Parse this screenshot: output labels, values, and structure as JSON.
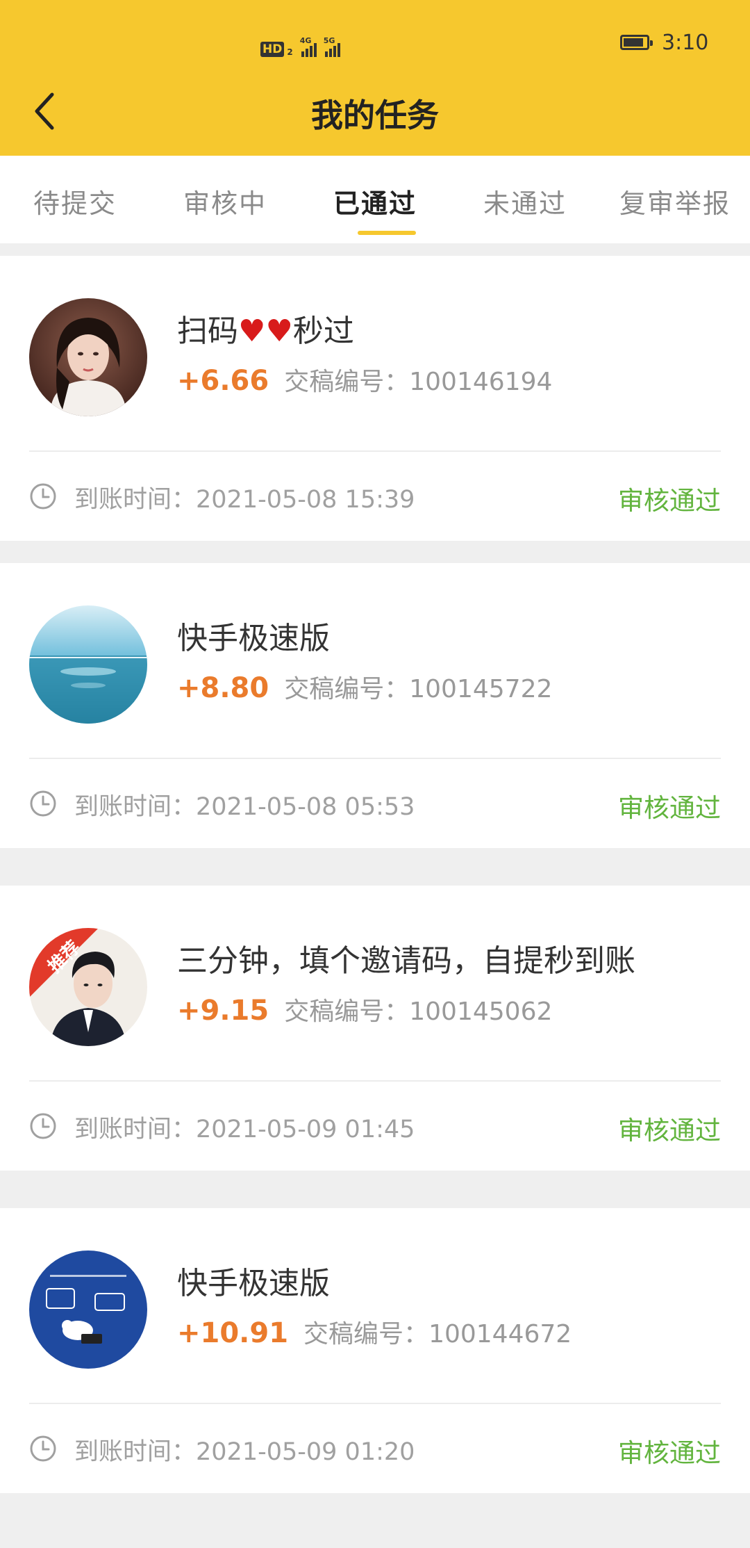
{
  "statusbar": {
    "network_badge": "HD",
    "network_sub": "2",
    "signal_1": "4G",
    "signal_2": "5G",
    "time": "3:10"
  },
  "header": {
    "title": "我的任务"
  },
  "tabs": [
    {
      "label": "待提交",
      "active": false
    },
    {
      "label": "审核中",
      "active": false
    },
    {
      "label": "已通过",
      "active": true
    },
    {
      "label": "未通过",
      "active": false
    },
    {
      "label": "复审举报",
      "active": false
    }
  ],
  "tasks": [
    {
      "title_text": "扫码",
      "title_suffix": "秒过",
      "reward": "+6.66",
      "submission_label": "交稿编号：",
      "submission_id": "100146194",
      "arrival_label": "到账时间：",
      "arrival_time": "2021-05-08 15:39",
      "status": "审核通过"
    },
    {
      "title": "快手极速版",
      "reward": "+8.80",
      "submission_label": "交稿编号：",
      "submission_id": "100145722",
      "arrival_label": "到账时间：",
      "arrival_time": "2021-05-08 05:53",
      "status": "审核通过"
    },
    {
      "title": "三分钟，填个邀请码，自提秒到账",
      "badge": "推荐",
      "reward": "+9.15",
      "submission_label": "交稿编号：",
      "submission_id": "100145062",
      "arrival_label": "到账时间：",
      "arrival_time": "2021-05-09 01:45",
      "status": "审核通过"
    },
    {
      "title": "快手极速版",
      "reward": "+10.91",
      "submission_label": "交稿编号：",
      "submission_id": "100144672",
      "arrival_label": "到账时间：",
      "arrival_time": "2021-05-09 01:20",
      "status": "审核通过"
    }
  ],
  "colors": {
    "header_bg": "#f6c82e",
    "reward": "#ea7b2c",
    "status_pass": "#62b43e"
  }
}
